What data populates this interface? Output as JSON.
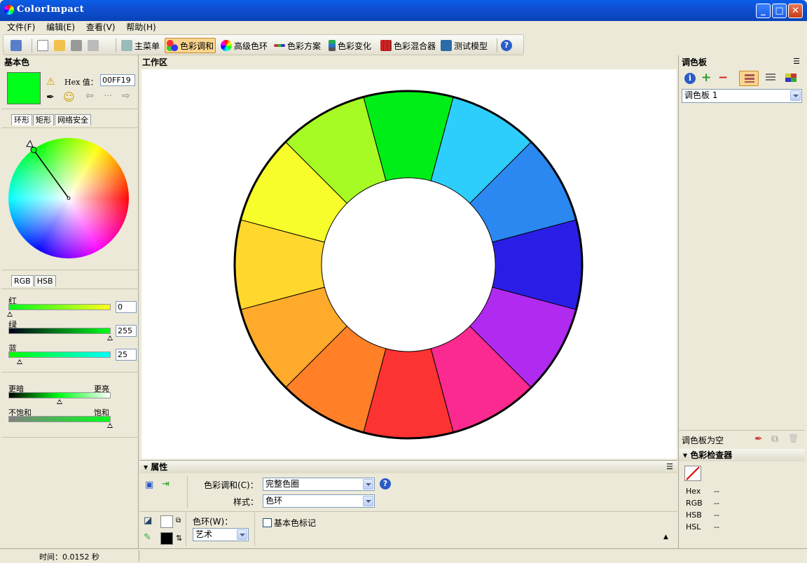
{
  "window": {
    "title": "ColorImpact"
  },
  "menu": [
    "文件(F)",
    "编辑(E)",
    "查看(V)",
    "帮助(H)"
  ],
  "toolbar": {
    "items": [
      "主菜单",
      "色彩调和",
      "高级色环",
      "色彩方案",
      "色彩变化",
      "色彩混合器",
      "测试模型"
    ]
  },
  "left": {
    "title": "基本色",
    "hex_label": "Hex 值：",
    "hex_value": "00FF19",
    "current_color": "#00ff19",
    "tabs1": [
      "环形",
      "矩形",
      "网络安全"
    ],
    "tabs2": [
      "RGB",
      "HSB"
    ],
    "red_label": "红",
    "red_value": "0",
    "green_label": "绿",
    "green_value": "255",
    "blue_label": "蓝",
    "blue_value": "25",
    "darker": "更暗",
    "brighter": "更亮",
    "unsat": "不饱和",
    "sat": "饱和"
  },
  "work": {
    "title": "工作区"
  },
  "wheel": {
    "colors": [
      "#00ee17",
      "#2dcefc",
      "#2a88f0",
      "#2a1ee6",
      "#b12af0",
      "#fa2a90",
      "#fd3232",
      "#ff8026",
      "#ffaa2a",
      "#ffd72d",
      "#f7fd2a",
      "#a7fb25"
    ]
  },
  "props": {
    "title": "属性",
    "harmony_label": "色彩调和(C)：",
    "harmony_value": "完整色圈",
    "style_label": "样式：",
    "style_value": "色环",
    "wheel_label": "色环(W)：",
    "wheel_value": "艺术",
    "basemark": "基本色标记"
  },
  "right": {
    "title": "调色板",
    "palette": "调色板 1",
    "empty": "调色板为空",
    "inspector_title": "色彩检查器",
    "rows": [
      {
        "k": "Hex",
        "v": "--"
      },
      {
        "k": "RGB",
        "v": "--"
      },
      {
        "k": "HSB",
        "v": "--"
      },
      {
        "k": "HSL",
        "v": "--"
      }
    ]
  },
  "status": {
    "time": "时间：0.0152 秒"
  }
}
